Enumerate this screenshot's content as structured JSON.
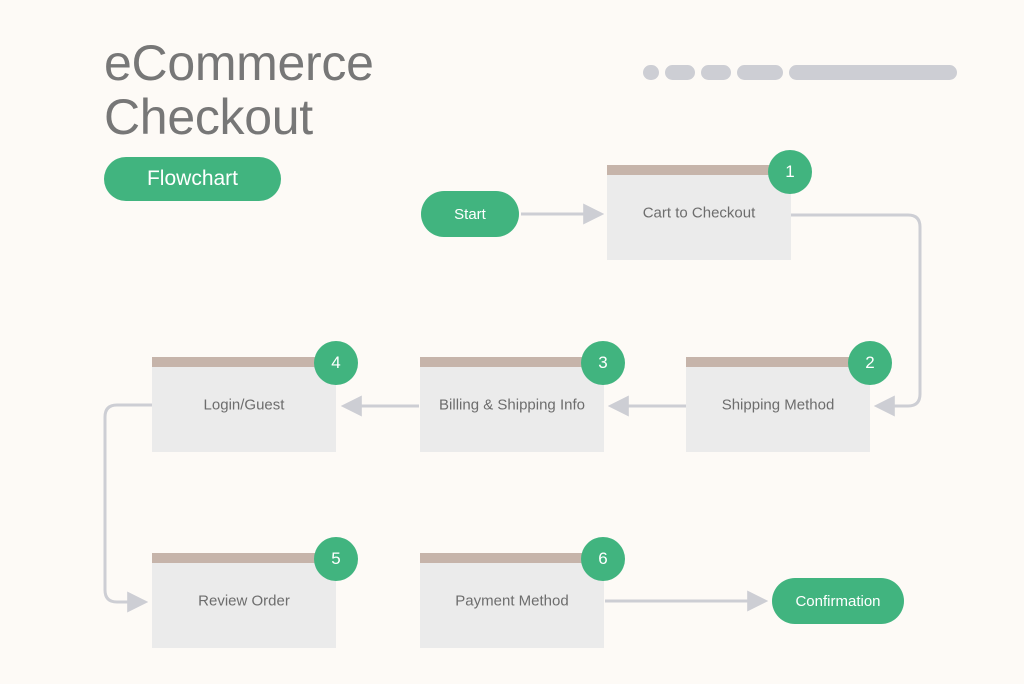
{
  "header": {
    "title": "eCommerce\nCheckout",
    "badge_label": "Flowchart"
  },
  "decor": {
    "pill_widths": [
      16,
      30,
      30,
      46,
      168
    ],
    "color": "#cdced4"
  },
  "colors": {
    "background": "#fdfaf6",
    "accent_green": "#41b47f",
    "node_fill": "#ebebeb",
    "node_topbar": "#c6b4aa",
    "connector": "#cdced4",
    "title_text": "#777777",
    "node_text": "#6d6d6d"
  },
  "terminals": [
    {
      "id": "start",
      "label": "Start"
    },
    {
      "id": "confirmation",
      "label": "Confirmation"
    }
  ],
  "steps": [
    {
      "number": "1",
      "label": "Cart to Checkout"
    },
    {
      "number": "2",
      "label": "Shipping Method"
    },
    {
      "number": "3",
      "label": "Billing & Shipping Info"
    },
    {
      "number": "4",
      "label": "Login/Guest"
    },
    {
      "number": "5",
      "label": "Review Order"
    },
    {
      "number": "6",
      "label": "Payment Method"
    }
  ],
  "flow_order": [
    "Start",
    "Cart to Checkout",
    "Shipping Method",
    "Billing & Shipping Info",
    "Login/Guest",
    "Review Order",
    "Payment Method",
    "Confirmation"
  ]
}
